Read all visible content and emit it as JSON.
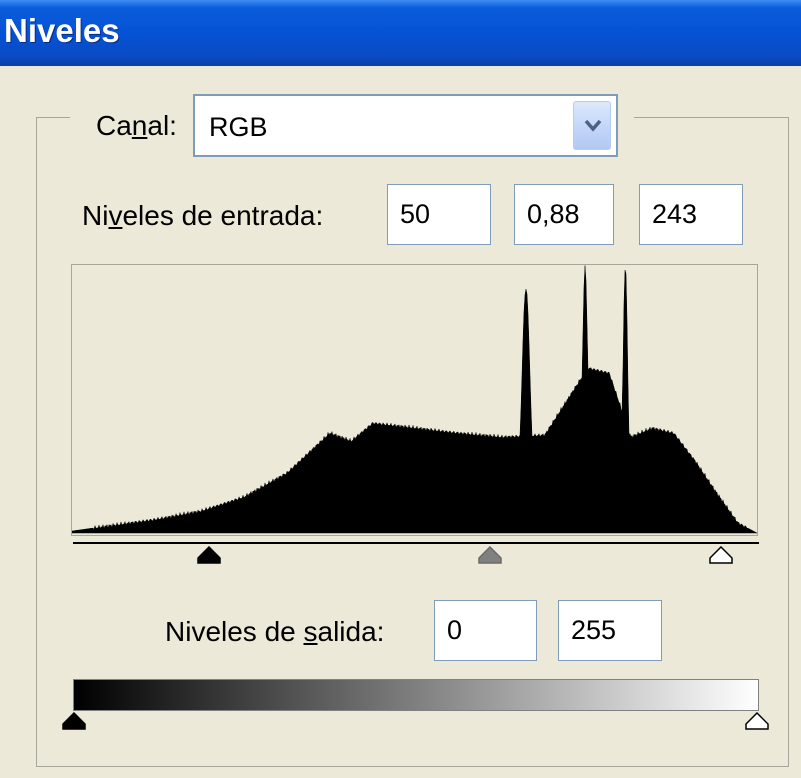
{
  "window": {
    "title": "Niveles"
  },
  "channel": {
    "label_pre": "Ca",
    "label_u": "n",
    "label_post": "al:",
    "value": "RGB"
  },
  "input_levels": {
    "label_pre": "Ni",
    "label_u": "v",
    "label_post": "eles de entrada:",
    "black": "50",
    "gamma": "0,88",
    "white": "243"
  },
  "output_levels": {
    "label_pre": "Niveles de ",
    "label_u": "s",
    "label_post": "alida:",
    "black": "0",
    "white": "255"
  },
  "sliders": {
    "input": {
      "black": 50,
      "gamma": 0.88,
      "white": 243
    },
    "output": {
      "black": 0,
      "white": 255
    }
  },
  "histogram": {
    "levels": [
      0,
      16,
      32,
      48,
      64,
      80,
      96,
      104,
      112,
      128,
      144,
      160,
      176,
      192,
      200,
      208,
      216,
      224,
      232,
      240,
      248,
      255
    ],
    "counts": [
      2,
      8,
      14,
      22,
      36,
      60,
      100,
      92,
      110,
      105,
      100,
      96,
      98,
      165,
      160,
      96,
      105,
      100,
      72,
      40,
      10,
      0
    ]
  },
  "colors": {
    "window_bg": "#ece9d8",
    "titlebar": "#0551d4",
    "field_border": "#7f9db9",
    "gamma_slider": "#808080"
  }
}
